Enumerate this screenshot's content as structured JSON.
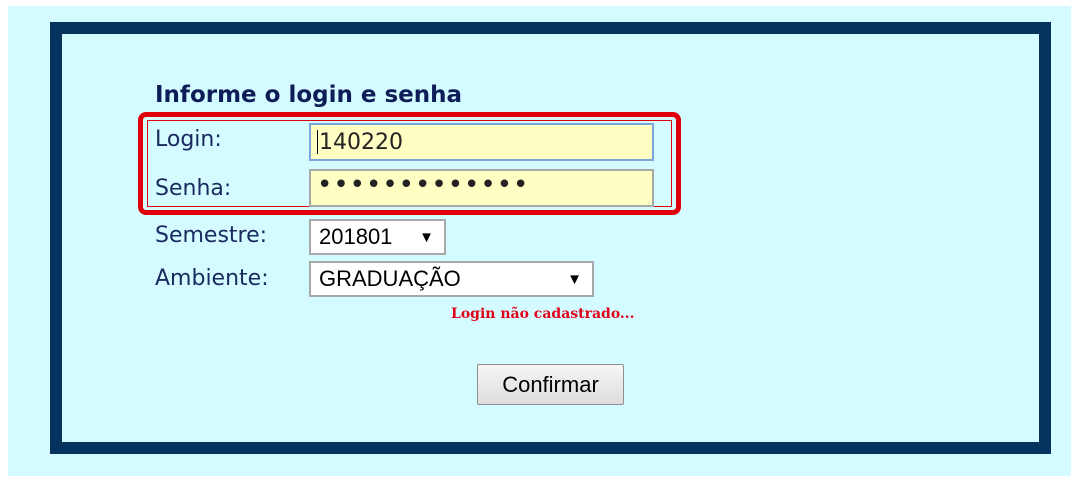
{
  "form": {
    "title": "Informe o login e senha",
    "login_label": "Login:",
    "login_value": "140220",
    "password_label": "Senha:",
    "password_masked": "•••••••••••••",
    "semester_label": "Semestre:",
    "semester_value": "201801",
    "environment_label": "Ambiente:",
    "environment_value": "GRADUAÇÃO",
    "dropdown_arrow": "▼",
    "error_message": "Login não cadastrado...",
    "confirm_label": "Confirmar"
  },
  "colors": {
    "page_background": "#d4fbff",
    "frame_border": "#05335e",
    "input_background": "#ffffc4",
    "highlight": "#e0000a",
    "error_text": "#e0001a",
    "label_text": "#1a2a5e"
  },
  "icons": {
    "dropdown": "chevron-down-icon"
  }
}
